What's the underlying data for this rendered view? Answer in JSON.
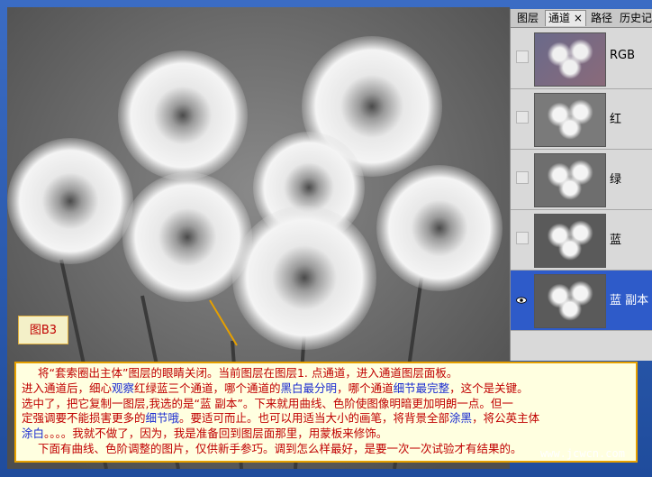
{
  "panel": {
    "tabs": [
      {
        "label": "图层"
      },
      {
        "label": "通道 ×"
      },
      {
        "label": "路径"
      },
      {
        "label": "历史记"
      }
    ],
    "channels": [
      {
        "label": "RGB",
        "visible": false
      },
      {
        "label": "红",
        "visible": false
      },
      {
        "label": "绿",
        "visible": false
      },
      {
        "label": "蓝",
        "visible": false
      },
      {
        "label": "蓝 副本",
        "visible": true,
        "selected": true
      }
    ]
  },
  "figure_label": "图B3",
  "note": {
    "line1": "将“套索圈出主体”图层的眼睛关闭。当前图层在图层1. 点通道，进入通道图层面板。",
    "line2a": "进入通道后，细心",
    "line2b": "观察",
    "line2c": "红绿蓝三个通道，哪个通道的",
    "line2d": "黑白最分明",
    "line2e": "，哪个通道",
    "line2f": "细节最完整",
    "line2g": "，这个是关键。",
    "line3": "选中了，把它复制一图层,我选的是“蓝   副本”。下来就用曲线、色阶使图像明暗更加明朗一点。但一",
    "line4a": "定强调要不能损害更多的",
    "line4b": "细节哦",
    "line4c": "。要适可而止。也可以用适当大小的画笔，将背景全部",
    "line4d": "涂黑",
    "line4e": "，将公英主体",
    "line5a": "涂白",
    "line5b": "。。。。我就不做了，因为，我是准备回到图层面那里，用蒙板来修饰。",
    "line6": "下面有曲线、色阶调整的图片，仅供新手参巧。调到怎么样最好，是要一次一次试验才有结果的。"
  },
  "watermark": "www.jcwcn.com",
  "colors": {
    "frame": "#2e5aa8",
    "note_text": "#c00000",
    "highlight_text": "#1a2bd0",
    "selected_channel": "#2e5bc9"
  }
}
